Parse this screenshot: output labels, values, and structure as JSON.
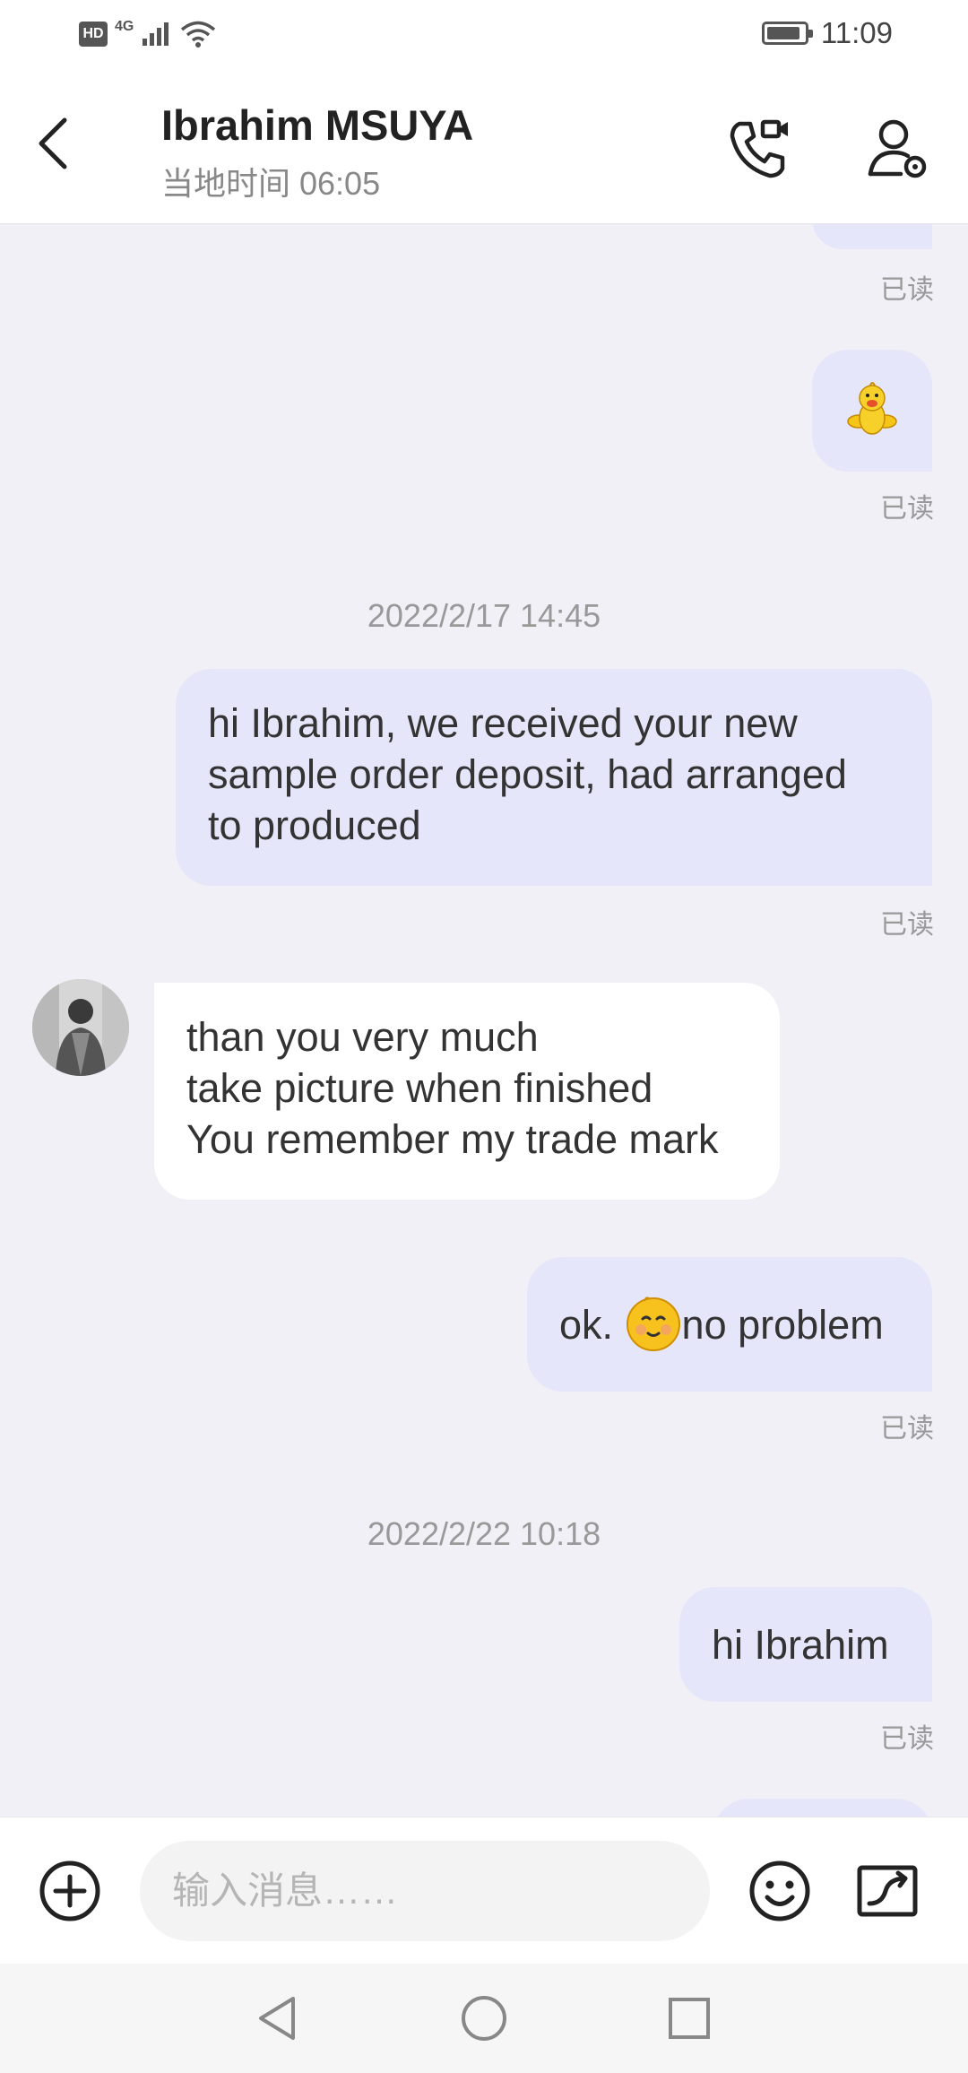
{
  "status_bar": {
    "hd_label": "HD",
    "network": "4G",
    "battery_level_pct": 90,
    "time": "11:09"
  },
  "header": {
    "title": "Ibrahim MSUYA",
    "subtitle": "当地时间 06:05",
    "icons": [
      "back-arrow-icon",
      "video-call-icon",
      "contact-settings-icon"
    ]
  },
  "chat": {
    "read_label": "已读",
    "messages": [
      {
        "type": "outgoing-emoji",
        "emoji": "yellow-chick-sticker",
        "status": "已读"
      },
      {
        "type": "timestamp",
        "text": "2022/2/17 14:45"
      },
      {
        "type": "outgoing",
        "lines": [
          "hi Ibrahim, we received your new",
          "sample order deposit, had arranged",
          "to produced"
        ],
        "status": "已读"
      },
      {
        "type": "incoming",
        "lines": [
          "than you very much",
          "take picture when finished",
          "You remember my trade mark"
        ]
      },
      {
        "type": "outgoing",
        "pre": "ok. ",
        "emoji": "smile-face",
        "post": "no problem",
        "status": "已读"
      },
      {
        "type": "timestamp",
        "text": "2022/2/22 10:18"
      },
      {
        "type": "outgoing",
        "lines": [
          "hi Ibrahim"
        ],
        "status": "已读"
      }
    ]
  },
  "input": {
    "placeholder": "输入消息……",
    "icons": [
      "add-icon",
      "emoji-icon",
      "quick-reply-icon"
    ]
  },
  "navbar": {
    "icons": [
      "nav-back-icon",
      "nav-home-icon",
      "nav-recents-icon"
    ]
  },
  "colors": {
    "outgoing_bubble": "#e6e6fa",
    "incoming_bubble": "#ffffff",
    "chat_background": "#f0f0f6"
  }
}
